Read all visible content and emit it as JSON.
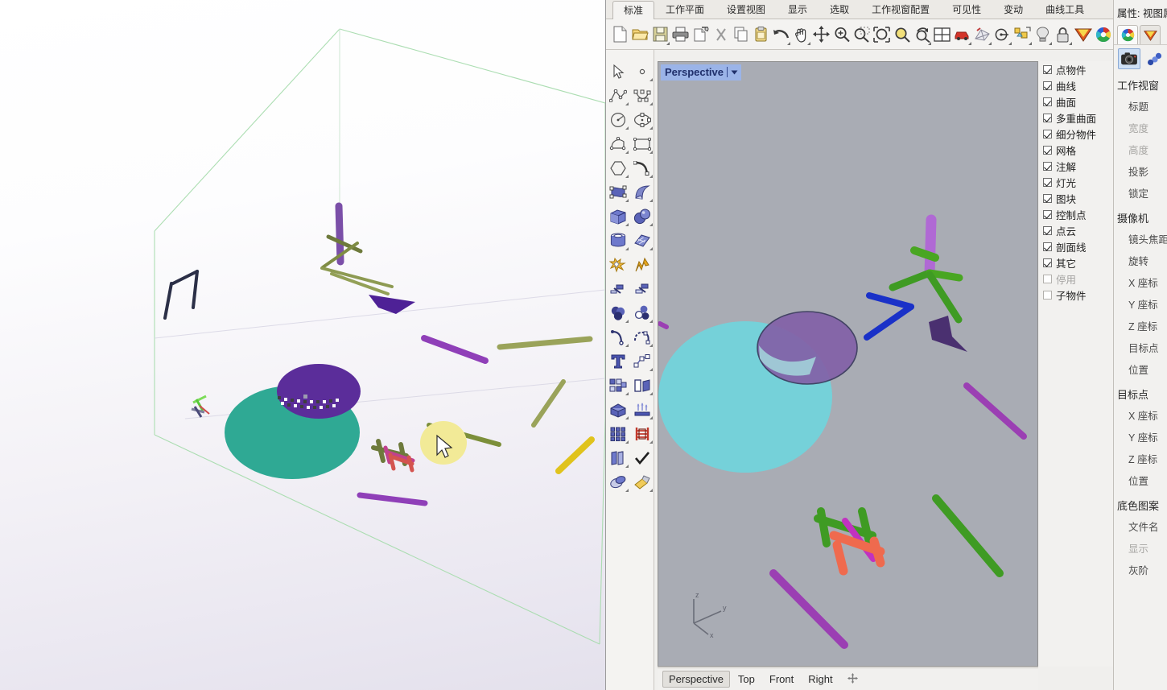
{
  "app": {
    "name": "rhino-3d-modeler",
    "tabs": [
      {
        "label": "标准",
        "active": true
      },
      {
        "label": "工作平面",
        "active": false
      },
      {
        "label": "设置视图",
        "active": false
      },
      {
        "label": "显示",
        "active": false
      },
      {
        "label": "选取",
        "active": false
      },
      {
        "label": "工作视窗配置",
        "active": false
      },
      {
        "label": "可见性",
        "active": false
      },
      {
        "label": "变动",
        "active": false
      },
      {
        "label": "曲线工具",
        "active": false
      }
    ]
  },
  "toolbar": {
    "items": [
      {
        "name": "new-file-icon",
        "tip": "新建"
      },
      {
        "name": "open-folder-icon",
        "tip": "开启"
      },
      {
        "name": "save-icon",
        "tip": "储存"
      },
      {
        "name": "print-icon",
        "tip": "列印"
      },
      {
        "name": "export-icon",
        "tip": "汇出"
      },
      {
        "name": "cut-scissors-icon",
        "tip": "剪下"
      },
      {
        "name": "copy-icon",
        "tip": "复制"
      },
      {
        "name": "paste-clipboard-icon",
        "tip": "贴上"
      },
      {
        "name": "undo-arrow-icon",
        "tip": "复原"
      },
      {
        "name": "pan-hand-icon",
        "tip": "平移"
      },
      {
        "name": "move-arrows-icon",
        "tip": "移动"
      },
      {
        "name": "zoom-in-icon",
        "tip": "放大"
      },
      {
        "name": "zoom-window-icon",
        "tip": "框选缩放"
      },
      {
        "name": "zoom-extents-icon",
        "tip": "缩放至范围"
      },
      {
        "name": "zoom-selected-icon",
        "tip": "缩放至选取物件"
      },
      {
        "name": "rotate-view-icon",
        "tip": "旋转视图"
      },
      {
        "name": "four-view-icon",
        "tip": "四视图"
      },
      {
        "name": "render-car-icon",
        "tip": "彩现"
      },
      {
        "name": "render-mesh-icon",
        "tip": "彩现网格"
      },
      {
        "name": "dimension-icon",
        "tip": "标注"
      },
      {
        "name": "block-icon",
        "tip": "图块"
      },
      {
        "name": "light-bulb-icon",
        "tip": "灯光"
      },
      {
        "name": "lock-icon",
        "tip": "锁定"
      },
      {
        "name": "material-icon",
        "tip": "材质"
      },
      {
        "name": "color-wheel-icon",
        "tip": "颜色"
      }
    ]
  },
  "sidetoolbar": {
    "items": [
      {
        "name": "select-arrow-icon"
      },
      {
        "name": "point-icon"
      },
      {
        "name": "polyline-icon"
      },
      {
        "name": "control-point-curve-icon"
      },
      {
        "name": "circle-icon"
      },
      {
        "name": "ellipse-icon"
      },
      {
        "name": "arc-icon"
      },
      {
        "name": "rectangle-icon"
      },
      {
        "name": "polygon-icon"
      },
      {
        "name": "curve-blend-icon"
      },
      {
        "name": "surface-from-points-icon"
      },
      {
        "name": "loft-surface-icon"
      },
      {
        "name": "box-icon"
      },
      {
        "name": "sphere-icon"
      },
      {
        "name": "cylinder-icon"
      },
      {
        "name": "surface-patch-icon"
      },
      {
        "name": "explode-icon"
      },
      {
        "name": "fillet-icon"
      },
      {
        "name": "trim-icon"
      },
      {
        "name": "split-icon"
      },
      {
        "name": "boolean-union-icon"
      },
      {
        "name": "boolean-difference-icon"
      },
      {
        "name": "offset-curve-icon"
      },
      {
        "name": "blend-curve-icon"
      },
      {
        "name": "text-icon"
      },
      {
        "name": "point-editing-icon"
      },
      {
        "name": "array-icon"
      },
      {
        "name": "mirror-icon"
      },
      {
        "name": "cap-holes-icon"
      },
      {
        "name": "extrude-icon"
      },
      {
        "name": "grid-array-icon"
      },
      {
        "name": "scale-icon"
      },
      {
        "name": "layer-icon"
      },
      {
        "name": "check-ok-icon"
      },
      {
        "name": "mesh-icon"
      },
      {
        "name": "render-paint-icon"
      }
    ]
  },
  "viewport": {
    "title": "Perspective",
    "tabs": [
      {
        "label": "Perspective",
        "active": true
      },
      {
        "label": "Top",
        "active": false
      },
      {
        "label": "Front",
        "active": false
      },
      {
        "label": "Right",
        "active": false
      }
    ],
    "add_tab_icon": "add-viewport-icon",
    "axis_gizmo": {
      "x": "x",
      "y": "y",
      "z": "z"
    },
    "background_color": "#a9acb4"
  },
  "filter_panel": {
    "items": [
      {
        "label": "点物件",
        "checked": true
      },
      {
        "label": "曲线",
        "checked": true
      },
      {
        "label": "曲面",
        "checked": true
      },
      {
        "label": "多重曲面",
        "checked": true
      },
      {
        "label": "细分物件",
        "checked": true
      },
      {
        "label": "网格",
        "checked": true
      },
      {
        "label": "注解",
        "checked": true
      },
      {
        "label": "灯光",
        "checked": true
      },
      {
        "label": "图块",
        "checked": true
      },
      {
        "label": "控制点",
        "checked": true
      },
      {
        "label": "点云",
        "checked": true
      },
      {
        "label": "剖面线",
        "checked": true
      },
      {
        "label": "其它",
        "checked": true
      },
      {
        "label": "停用",
        "checked": false
      },
      {
        "label": "子物件",
        "checked": false
      }
    ]
  },
  "properties": {
    "title": "属性: 视图属性",
    "tabs": [
      {
        "name": "color-wheel-icon",
        "active": true
      },
      {
        "name": "material-icon",
        "active": false
      }
    ],
    "icons": [
      {
        "name": "camera-icon",
        "selected": true
      },
      {
        "name": "link-chain-icon",
        "selected": false
      }
    ],
    "sections": [
      {
        "heading": "工作视窗",
        "rows": [
          {
            "label": "标题",
            "dim": false
          },
          {
            "label": "宽度",
            "dim": true
          },
          {
            "label": "高度",
            "dim": true
          },
          {
            "label": "投影",
            "dim": false
          },
          {
            "label": "锁定",
            "dim": false
          }
        ]
      },
      {
        "heading": "摄像机",
        "rows": [
          {
            "label": "镜头焦距",
            "dim": false
          },
          {
            "label": "旋转",
            "dim": false
          },
          {
            "label": "X 座标",
            "dim": false
          },
          {
            "label": "Y 座标",
            "dim": false
          },
          {
            "label": "Z 座标",
            "dim": false
          },
          {
            "label": "目标点",
            "dim": false
          },
          {
            "label": "位置",
            "dim": false
          }
        ]
      },
      {
        "heading": "目标点",
        "rows": [
          {
            "label": "X 座标",
            "dim": false
          },
          {
            "label": "Y 座标",
            "dim": false
          },
          {
            "label": "Z 座标",
            "dim": false
          },
          {
            "label": "位置",
            "dim": false
          }
        ]
      },
      {
        "heading": "底色图案",
        "rows": [
          {
            "label": "文件名",
            "dim": false
          },
          {
            "label": "显示",
            "dim": true
          },
          {
            "label": "灰阶",
            "dim": false
          }
        ]
      }
    ]
  },
  "scene": {
    "description": "3D scene with teal ellipsoid, purple disc, colored rod primitives and polyline curves",
    "colors": {
      "teal_sphere": "#2fa994",
      "teal_sphere_vp": "#74d2da",
      "purple_disc": "#5b2d9a",
      "purple_disc_vp": "#8361a8",
      "yellow_disc": "#f2ea97",
      "magenta_rod": "#9b3fb3",
      "olive_rod": "#9aa35a",
      "green_rod": "#3f9b23",
      "red_rod": "#ef6a4e",
      "blue_curve": "#1a31c8",
      "dark_curve": "#2b2f47",
      "bbox_line": "#9fd4a6",
      "gold_rod": "#e0c31c"
    }
  }
}
